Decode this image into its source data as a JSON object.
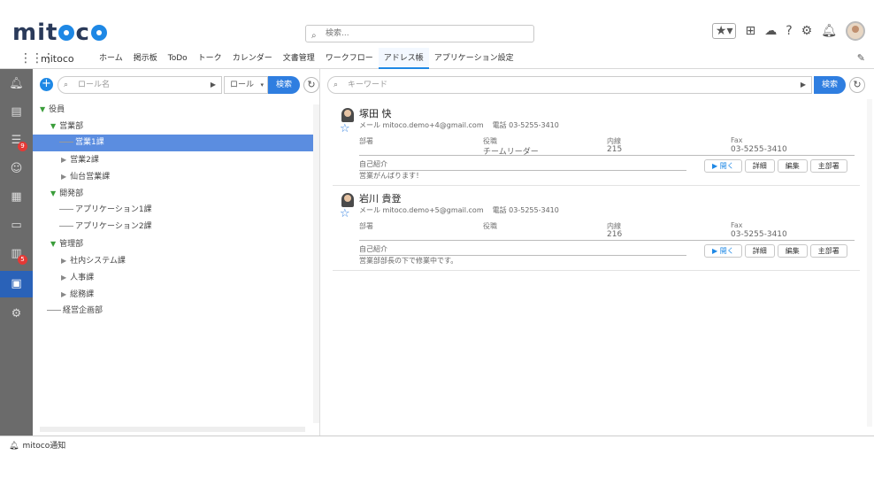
{
  "header": {
    "search_placeholder": "検索...",
    "app_title": "mitoco",
    "nav_items": [
      "ホーム",
      "掲示板",
      "ToDo",
      "トーク",
      "カレンダー",
      "文書管理",
      "ワークフロー",
      "アドレス帳",
      "アプリケーション設定"
    ],
    "active_nav": "アドレス帳"
  },
  "iconbar": {
    "badges": {
      "todo": "9",
      "workflow": "5"
    }
  },
  "left_panel": {
    "role_placeholder": "ロール名",
    "role_select": "ロール",
    "search_label": "検索",
    "tree": [
      {
        "label": "役員",
        "level": 0,
        "type": "open"
      },
      {
        "label": "営業部",
        "level": 1,
        "type": "open"
      },
      {
        "label": "営業1課",
        "level": 2,
        "type": "leaf",
        "selected": true
      },
      {
        "label": "営業2課",
        "level": 2,
        "type": "closed"
      },
      {
        "label": "仙台営業課",
        "level": 2,
        "type": "closed"
      },
      {
        "label": "開発部",
        "level": 1,
        "type": "open"
      },
      {
        "label": "アプリケーション1課",
        "level": 2,
        "type": "leaf"
      },
      {
        "label": "アプリケーション2課",
        "level": 2,
        "type": "leaf"
      },
      {
        "label": "管理部",
        "level": 1,
        "type": "open"
      },
      {
        "label": "社内システム課",
        "level": 2,
        "type": "closed"
      },
      {
        "label": "人事課",
        "level": 2,
        "type": "closed"
      },
      {
        "label": "総務課",
        "level": 2,
        "type": "closed"
      },
      {
        "label": "経営企画部",
        "level": 1,
        "type": "leaf"
      }
    ]
  },
  "right_panel": {
    "keyword_placeholder": "キーワード",
    "search_label": "検索",
    "headers": {
      "dept": "部署",
      "title": "役職",
      "ext": "内線",
      "fax": "Fax",
      "intro": "自己紹介"
    },
    "cards": [
      {
        "name": "塚田 快",
        "email": "メール mitoco.demo+4@gmail.com",
        "phone": "電話 03-5255-3410",
        "title": "チームリーダー",
        "ext": "215",
        "fax": "03-5255-3410",
        "intro": "営業がんばります！"
      },
      {
        "name": "岩川 貴登",
        "email": "メール mitoco.demo+5@gmail.com",
        "phone": "電話 03-5255-3410",
        "title": "",
        "ext": "216",
        "fax": "03-5255-3410",
        "intro": "営業部部長の下で修業中です。"
      }
    ],
    "buttons": {
      "open": "▶ 開く",
      "detail": "詳細",
      "edit": "編集",
      "main_dept": "主部署"
    }
  },
  "footer": {
    "label": "mitoco通知"
  }
}
